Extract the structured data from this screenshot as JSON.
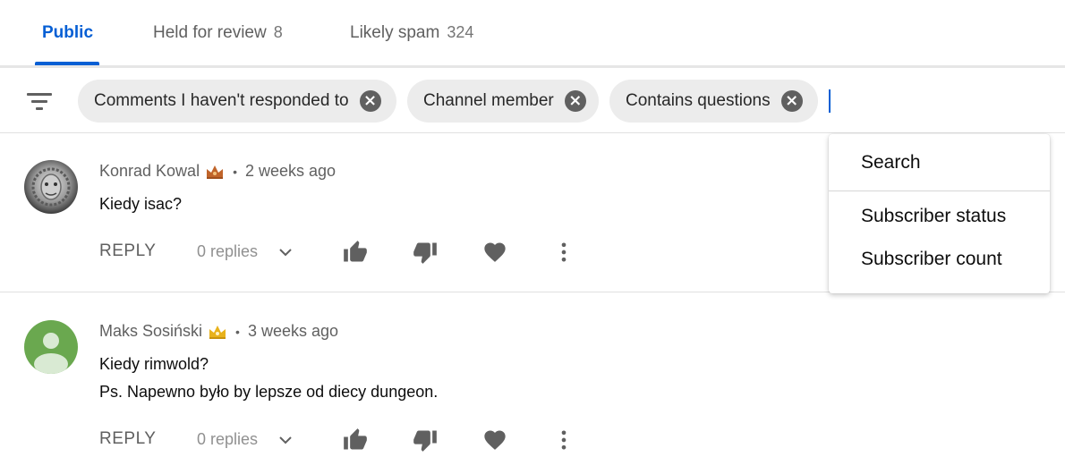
{
  "tabs": [
    {
      "label": "Public",
      "count": ""
    },
    {
      "label": "Held for review",
      "count": "8"
    },
    {
      "label": "Likely spam",
      "count": "324"
    }
  ],
  "filters": {
    "chips": [
      {
        "label": "Comments I haven't responded to"
      },
      {
        "label": "Channel member"
      },
      {
        "label": "Contains questions"
      }
    ],
    "close_glyph": "×"
  },
  "dropdown": {
    "items": [
      "Search",
      "Subscriber status",
      "Subscriber count"
    ]
  },
  "comments": [
    {
      "author": "Konrad Kowal",
      "badge_icon": "crown-icon",
      "badge_color": "#c0642a",
      "separator": "•",
      "time": "2 weeks ago",
      "lines": [
        "Kiedy isac?"
      ],
      "reply_label": "REPLY",
      "replies_label": "0 replies"
    },
    {
      "author": "Maks Sosiński",
      "badge_icon": "crown-icon",
      "badge_color": "#e8b21b",
      "separator": "•",
      "time": "3 weeks ago",
      "lines": [
        "Kiedy rimwold?",
        "Ps. Napewno było by lepsze od diecy dungeon."
      ],
      "reply_label": "REPLY",
      "replies_label": "0 replies"
    }
  ],
  "colors": {
    "accent": "#065fd4",
    "avatar_green": "#6aa84f",
    "icon_gray": "#606060"
  }
}
